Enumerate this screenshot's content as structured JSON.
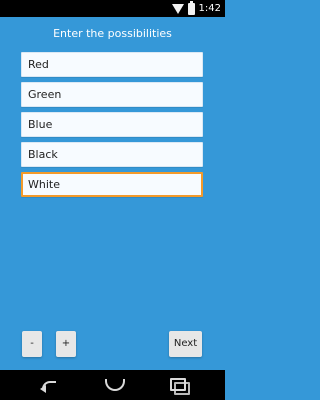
{
  "statusbar": {
    "time": "1:42",
    "icons": [
      "wifi-icon",
      "battery-icon"
    ]
  },
  "screen": {
    "title": "Enter the possibilities",
    "fields": [
      {
        "value": "Red"
      },
      {
        "value": "Green"
      },
      {
        "value": "Blue"
      },
      {
        "value": "Black"
      },
      {
        "value": "White",
        "focused": true
      }
    ],
    "buttons": {
      "minus": "-",
      "plus": "+",
      "next": "Next"
    }
  },
  "colors": {
    "background": "#3598d8",
    "focus": "#f39a2b"
  },
  "navbar": {
    "icons": [
      "back-icon",
      "home-icon",
      "recent-apps-icon"
    ]
  }
}
